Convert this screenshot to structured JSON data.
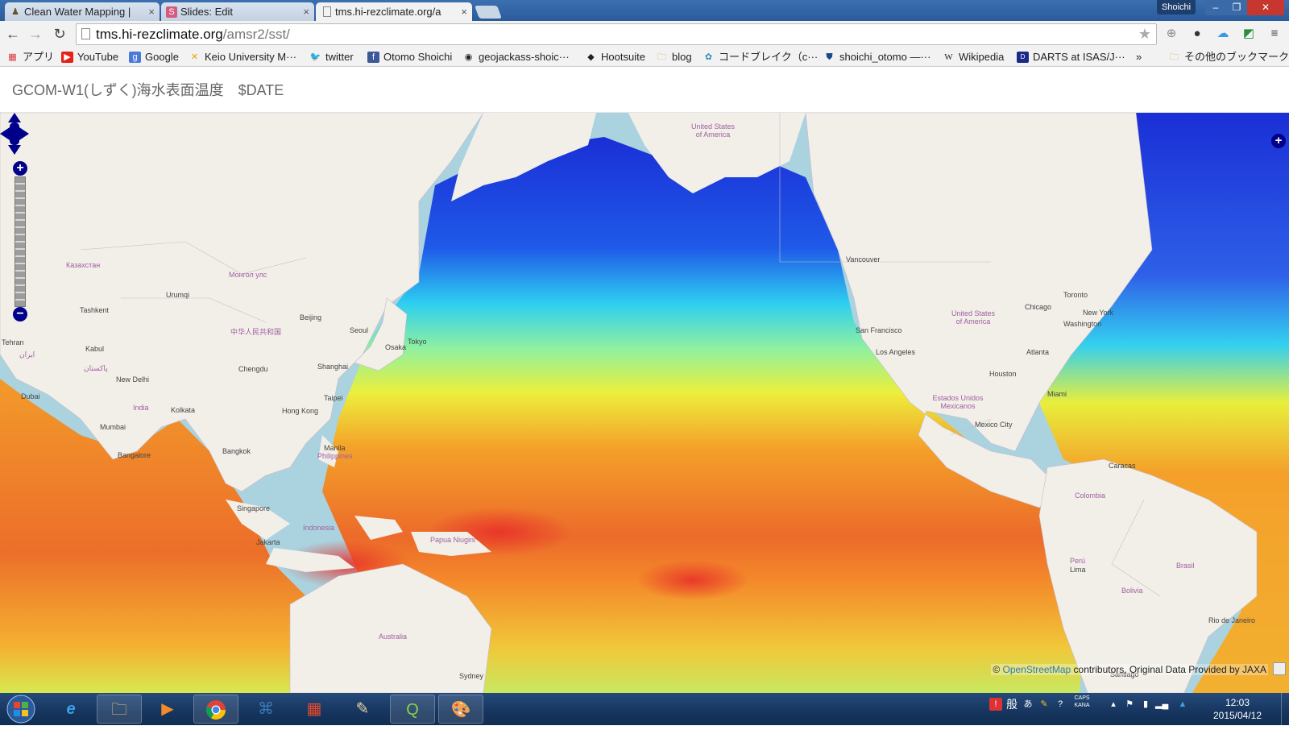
{
  "tabs": [
    {
      "title": "Clean Water Mapping |",
      "icon": "person-icon",
      "active": false
    },
    {
      "title": "Slides: Edit",
      "icon": "slides-icon",
      "active": false
    },
    {
      "title": "tms.hi-rezclimate.org/a",
      "icon": "page-icon",
      "active": true
    }
  ],
  "profile_name": "Shoichi",
  "address": {
    "host": "tms.hi-rezclimate.org",
    "path": "/amsr2/sst/"
  },
  "bookmarks": [
    {
      "label": "アプリ",
      "icon": "apps-grid-icon"
    },
    {
      "label": "YouTube",
      "icon": "youtube-icon"
    },
    {
      "label": "Google",
      "icon": "google-icon"
    },
    {
      "label": "Keio University M···",
      "icon": "keio-icon"
    },
    {
      "label": "twitter",
      "icon": "twitter-bird-icon"
    },
    {
      "label": "Otomo Shoichi",
      "icon": "facebook-icon"
    },
    {
      "label": "geojackass-shoic···",
      "icon": "github-icon"
    },
    {
      "label": "Hootsuite",
      "icon": "hootsuite-icon"
    },
    {
      "label": "blog",
      "icon": "folder-icon"
    },
    {
      "label": "コードブレイク（c···",
      "icon": "codebreak-icon"
    },
    {
      "label": "shoichi_otomo —···",
      "icon": "shield-icon"
    },
    {
      "label": "Wikipedia",
      "icon": "wikipedia-icon"
    },
    {
      "label": "DARTS at ISAS/J···",
      "icon": "darts-icon"
    }
  ],
  "bookmarks_overflow": "»",
  "other_bookmarks": "その他のブックマーク",
  "page_title": "GCOM-W1(しずく)海水表面温度　$DATE",
  "map_labels": [
    {
      "text": "United States of America",
      "kind": "country"
    },
    {
      "text": "Казахстан",
      "kind": "country"
    },
    {
      "text": "Монгол улс",
      "kind": "country"
    },
    {
      "text": "中华人民共和国",
      "kind": "country"
    },
    {
      "text": "Urumqi",
      "kind": "city"
    },
    {
      "text": "Tashkent",
      "kind": "city"
    },
    {
      "text": "Beijing",
      "kind": "city"
    },
    {
      "text": "Seoul",
      "kind": "city"
    },
    {
      "text": "Osaka",
      "kind": "city"
    },
    {
      "text": "Tokyo",
      "kind": "city"
    },
    {
      "text": "Tehran",
      "kind": "city"
    },
    {
      "text": "ایران",
      "kind": "country"
    },
    {
      "text": "Kabul",
      "kind": "city"
    },
    {
      "text": "پاکستان",
      "kind": "country"
    },
    {
      "text": "New Delhi",
      "kind": "city"
    },
    {
      "text": "Chengdu",
      "kind": "city"
    },
    {
      "text": "Shanghai",
      "kind": "city"
    },
    {
      "text": "Taipei",
      "kind": "city"
    },
    {
      "text": "Hong Kong",
      "kind": "city"
    },
    {
      "text": "India",
      "kind": "country"
    },
    {
      "text": "Kolkata",
      "kind": "city"
    },
    {
      "text": "Mumbai",
      "kind": "city"
    },
    {
      "text": "Dubai",
      "kind": "city"
    },
    {
      "text": "Bangalore",
      "kind": "city"
    },
    {
      "text": "Bangkok",
      "kind": "city"
    },
    {
      "text": "Manila",
      "kind": "city"
    },
    {
      "text": "Philippines",
      "kind": "country"
    },
    {
      "text": "Singapore",
      "kind": "city"
    },
    {
      "text": "Indonesia",
      "kind": "country"
    },
    {
      "text": "Jakarta",
      "kind": "city"
    },
    {
      "text": "Papua Niugini",
      "kind": "country"
    },
    {
      "text": "Australia",
      "kind": "country"
    },
    {
      "text": "Sydney",
      "kind": "city"
    },
    {
      "text": "Vancouver",
      "kind": "city"
    },
    {
      "text": "San Francisco",
      "kind": "city"
    },
    {
      "text": "Los Angeles",
      "kind": "city"
    },
    {
      "text": "Chicago",
      "kind": "city"
    },
    {
      "text": "Toronto",
      "kind": "city"
    },
    {
      "text": "New York",
      "kind": "city"
    },
    {
      "text": "Washington",
      "kind": "city"
    },
    {
      "text": "United States of America",
      "kind": "country"
    },
    {
      "text": "Atlanta",
      "kind": "city"
    },
    {
      "text": "Houston",
      "kind": "city"
    },
    {
      "text": "Miami",
      "kind": "city"
    },
    {
      "text": "Estados Unidos Mexicanos",
      "kind": "country"
    },
    {
      "text": "Mexico City",
      "kind": "city"
    },
    {
      "text": "Caracas",
      "kind": "city"
    },
    {
      "text": "Colombia",
      "kind": "country"
    },
    {
      "text": "Perú",
      "kind": "country"
    },
    {
      "text": "Lima",
      "kind": "city"
    },
    {
      "text": "Brasil",
      "kind": "country"
    },
    {
      "text": "Bolivia",
      "kind": "country"
    },
    {
      "text": "Rio de Janeiro",
      "kind": "city"
    },
    {
      "text": "Santiago",
      "kind": "city"
    }
  ],
  "map_controls": {
    "zoom_in": "+",
    "zoom_out": "−",
    "layer_switcher": "+"
  },
  "attribution": {
    "prefix": "© ",
    "osm": "OpenStreetMap",
    "suffix": " contributors, Original Data Provided by JAXA"
  },
  "taskbar": {
    "apps": [
      "internet-explorer-icon",
      "file-explorer-icon",
      "media-player-icon",
      "chrome-icon",
      "python-icon",
      "apps-grid-icon",
      "pen-tool-icon",
      "qgis-icon",
      "paint-icon"
    ],
    "tray_ime": "般",
    "tray_caps": "CAPS",
    "tray_kana": "KANA",
    "time": "12:03",
    "date": "2015/04/12"
  },
  "colors": {
    "ocean_default": "#aad3df",
    "land": "#f2efe9",
    "sst_cold": "#1c2fcf",
    "sst_mid": "#e8ea3a",
    "sst_warm": "#e8382a",
    "nav_dark": "#00008b"
  }
}
